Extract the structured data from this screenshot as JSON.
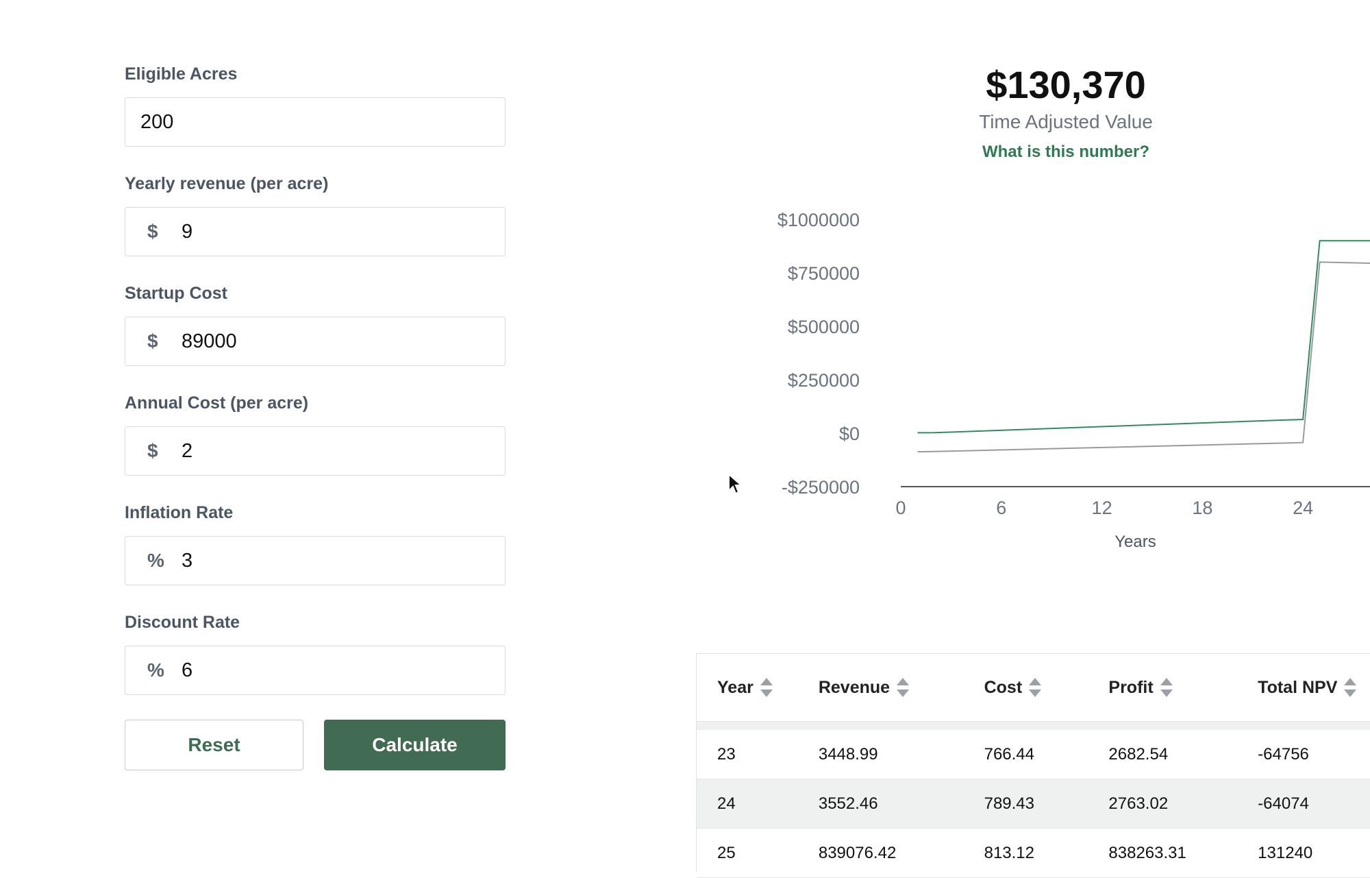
{
  "form": {
    "eligible_acres": {
      "label": "Eligible Acres",
      "value": "200"
    },
    "yearly_revenue": {
      "label": "Yearly revenue (per acre)",
      "prefix": "$",
      "value": "9"
    },
    "startup_cost": {
      "label": "Startup Cost",
      "prefix": "$",
      "value": "89000"
    },
    "annual_cost": {
      "label": "Annual Cost (per acre)",
      "prefix": "$",
      "value": "2"
    },
    "inflation_rate": {
      "label": "Inflation Rate",
      "prefix": "%",
      "value": "3"
    },
    "discount_rate": {
      "label": "Discount Rate",
      "prefix": "%",
      "value": "6"
    },
    "reset_label": "Reset",
    "calculate_label": "Calculate"
  },
  "summary": {
    "value": "$130,370",
    "label": "Time Adjusted Value",
    "help_link": "What is this number?"
  },
  "chart_data": {
    "type": "line",
    "xlabel": "Years",
    "ylabel": "",
    "x_ticks": [
      "0",
      "6",
      "12",
      "18",
      "24"
    ],
    "y_ticks": [
      "$1000000",
      "$750000",
      "$500000",
      "$250000",
      "$0",
      "-$250000"
    ],
    "xlim": [
      0,
      28
    ],
    "ylim": [
      -250000,
      1000000
    ],
    "x": [
      1,
      2,
      23,
      24,
      25,
      28
    ],
    "series": [
      {
        "color": "#2e8b62",
        "values": [
          2000,
          2100,
          62000,
          64000,
          900000,
          900000
        ]
      },
      {
        "color": "#9a9a9a",
        "values": [
          -87000,
          -86000,
          -46000,
          -44000,
          800000,
          795000
        ]
      }
    ],
    "baseline_color": "#555555"
  },
  "table": {
    "columns": [
      "Year",
      "Revenue",
      "Cost",
      "Profit",
      "Total NPV"
    ],
    "rows": [
      [
        "23",
        "3448.99",
        "766.44",
        "2682.54",
        "-64756"
      ],
      [
        "24",
        "3552.46",
        "789.43",
        "2763.02",
        "-64074"
      ],
      [
        "25",
        "839076.42",
        "813.12",
        "838263.31",
        "131240"
      ]
    ]
  }
}
